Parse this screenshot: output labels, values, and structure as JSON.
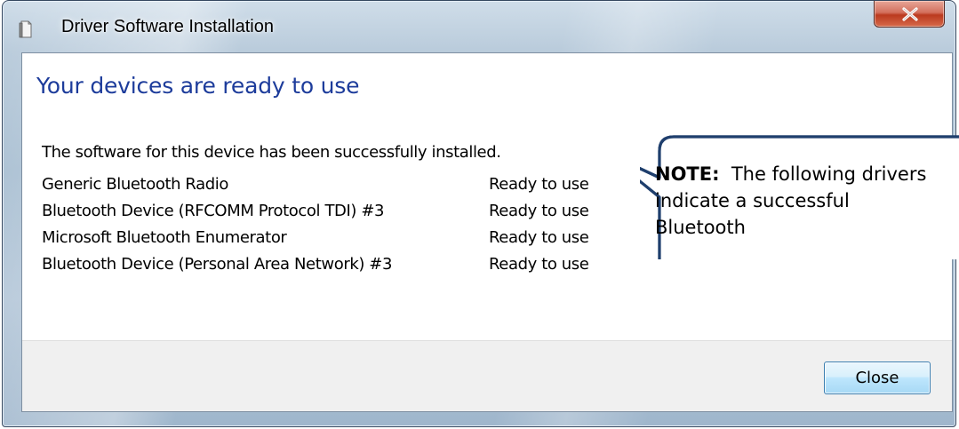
{
  "window": {
    "title": "Driver Software Installation",
    "close_glyph": "x"
  },
  "dialog": {
    "heading": "Your devices are ready to use",
    "message": "The software for this device has been successfully installed.",
    "devices": [
      {
        "name": "Generic Bluetooth Radio",
        "status": "Ready to use"
      },
      {
        "name": "Bluetooth Device (RFCOMM Protocol TDI) #3",
        "status": "Ready to use"
      },
      {
        "name": "Microsoft Bluetooth Enumerator",
        "status": "Ready to use"
      },
      {
        "name": "Bluetooth Device (Personal Area Network) #3",
        "status": "Ready to use"
      }
    ],
    "close_button": "Close"
  },
  "callout": {
    "label": "NOTE:",
    "text": "The following drivers indicate a successful Bluetooth"
  },
  "colors": {
    "heading": "#1d3c9b",
    "callout_border": "#1f3f6d",
    "close_button_border": "#3c7fb1"
  },
  "icons": {
    "app": "document-icon",
    "window_close": "close-icon"
  }
}
